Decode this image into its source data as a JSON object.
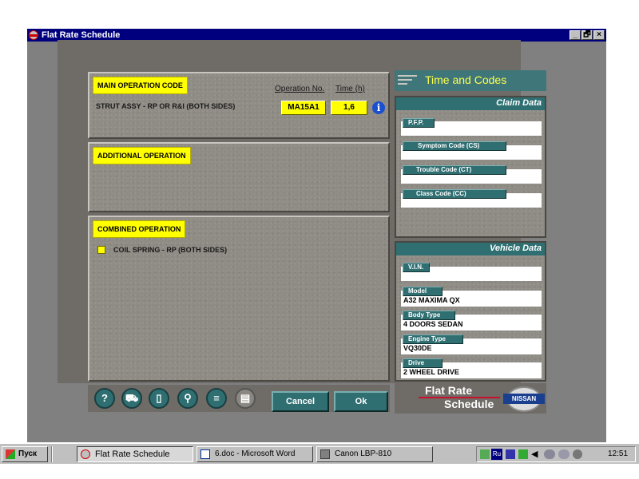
{
  "window": {
    "title": "Flat Rate Schedule",
    "controls": [
      "_",
      "🗗",
      "×"
    ]
  },
  "main_operation": {
    "label": "MAIN OPERATION CODE",
    "description": "STRUT ASSY - RP OR R&I (BOTH SIDES)",
    "col_operation_no": "Operation No.",
    "col_time": "Time (h)",
    "operation_no": "MA15A1",
    "time": "1,6"
  },
  "additional_operation": {
    "label": "ADDITIONAL OPERATION"
  },
  "combined_operation": {
    "label": "COMBINED OPERATION",
    "items": [
      {
        "text": "COIL SPRING - RP (BOTH SIDES)",
        "checked": false
      }
    ]
  },
  "time_codes": {
    "title": "Time and Codes"
  },
  "claim_data": {
    "title": "Claim Data",
    "fields": [
      {
        "label": "P.F.P.",
        "value": ""
      },
      {
        "label": "Symptom Code (CS)",
        "value": ""
      },
      {
        "label": "Trouble Code (CT)",
        "value": ""
      },
      {
        "label": "Class Code (CC)",
        "value": ""
      }
    ]
  },
  "vehicle_data": {
    "title": "Vehicle Data",
    "fields": [
      {
        "label": "V.I.N.",
        "value": ""
      },
      {
        "label": "Model",
        "value": "A32 MAXIMA QX"
      },
      {
        "label": "Body Type",
        "value": "4 DOORS SEDAN"
      },
      {
        "label": "Engine Type",
        "value": "VQ30DE"
      },
      {
        "label": "Drive",
        "value": "2 WHEEL DRIVE"
      }
    ]
  },
  "toolbar": {
    "icons": [
      {
        "name": "help-icon",
        "glyph": "?"
      },
      {
        "name": "car-icon",
        "glyph": "⛟"
      },
      {
        "name": "door-icon",
        "glyph": "▯"
      },
      {
        "name": "search-icon",
        "glyph": "⚲"
      },
      {
        "name": "print-icon",
        "glyph": "≡"
      },
      {
        "name": "document-icon",
        "glyph": "▤"
      }
    ],
    "cancel_label": "Cancel",
    "ok_label": "Ok"
  },
  "brand": {
    "line1": "Flat Rate",
    "line2": "Schedule",
    "logo": "NISSAN"
  },
  "taskbar": {
    "start_label": "Пуск",
    "items": [
      {
        "label": "Flat Rate Schedule",
        "active": true
      },
      {
        "label": "6.doc - Microsoft Word",
        "active": false
      },
      {
        "label": "Canon LBP-810",
        "active": false
      }
    ],
    "tray_lang": "Ru",
    "clock": "12:51"
  },
  "colors": {
    "accent_yellow": "#ffff00",
    "teal": "#2f6f72",
    "titlebar": "#00007f"
  }
}
